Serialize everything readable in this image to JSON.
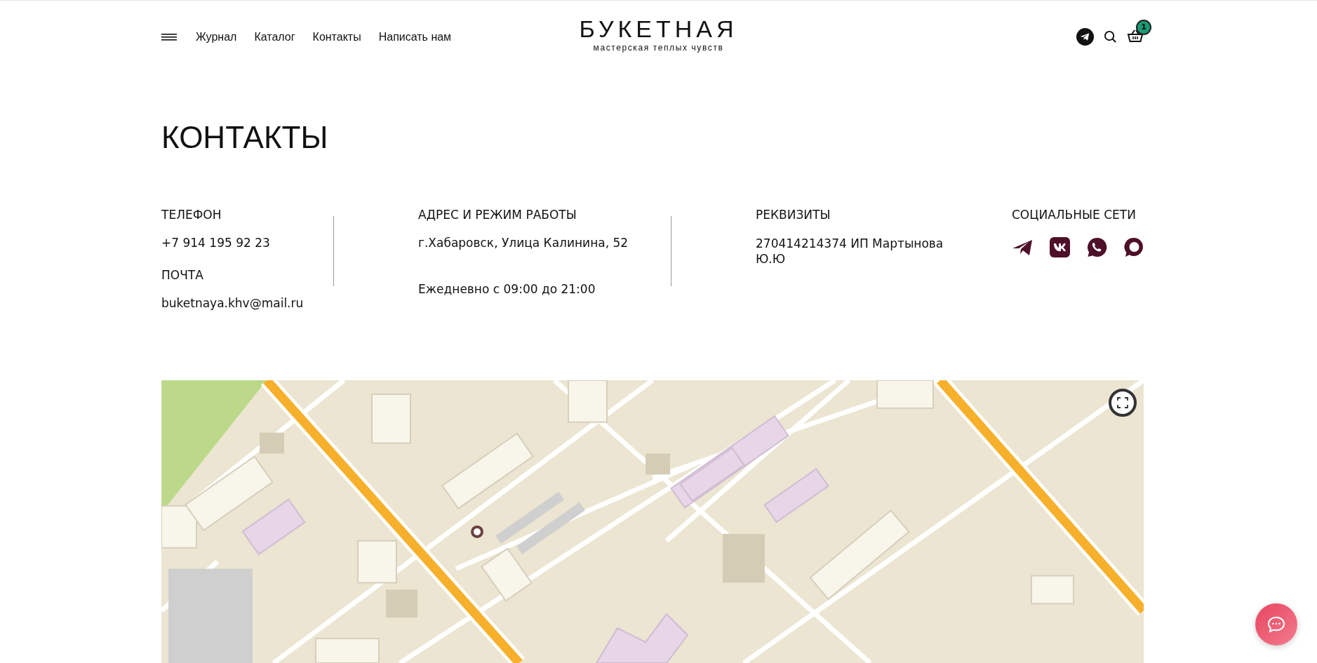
{
  "header": {
    "nav": [
      {
        "label": "Журнал"
      },
      {
        "label": "Каталог"
      },
      {
        "label": "Контакты"
      },
      {
        "label": "Написать нам"
      }
    ],
    "logo": {
      "title": "БУКЕТНАЯ",
      "subtitle": "мастерская теплых чувств"
    },
    "cart_count": "1"
  },
  "page_title": "КОНТАКТЫ",
  "phone": {
    "heading": "ТЕЛЕФОН",
    "value": "+7 914 195 92 23"
  },
  "email": {
    "heading": "ПОЧТА",
    "value": "buketnaya.khv@mail.ru"
  },
  "address": {
    "heading": "АДРЕС И РЕЖИМ РАБОТЫ",
    "address": "г.Хабаровск, Улица Калинина, 52",
    "hours": "Ежедневно с 09:00 до 21:00"
  },
  "requisites": {
    "heading": "РЕКВИЗИТЫ",
    "text": "270414214374 ИП Мартынова Ю.Ю"
  },
  "social": {
    "heading": "СОЦИАЛЬНЫЕ СЕТИ"
  }
}
